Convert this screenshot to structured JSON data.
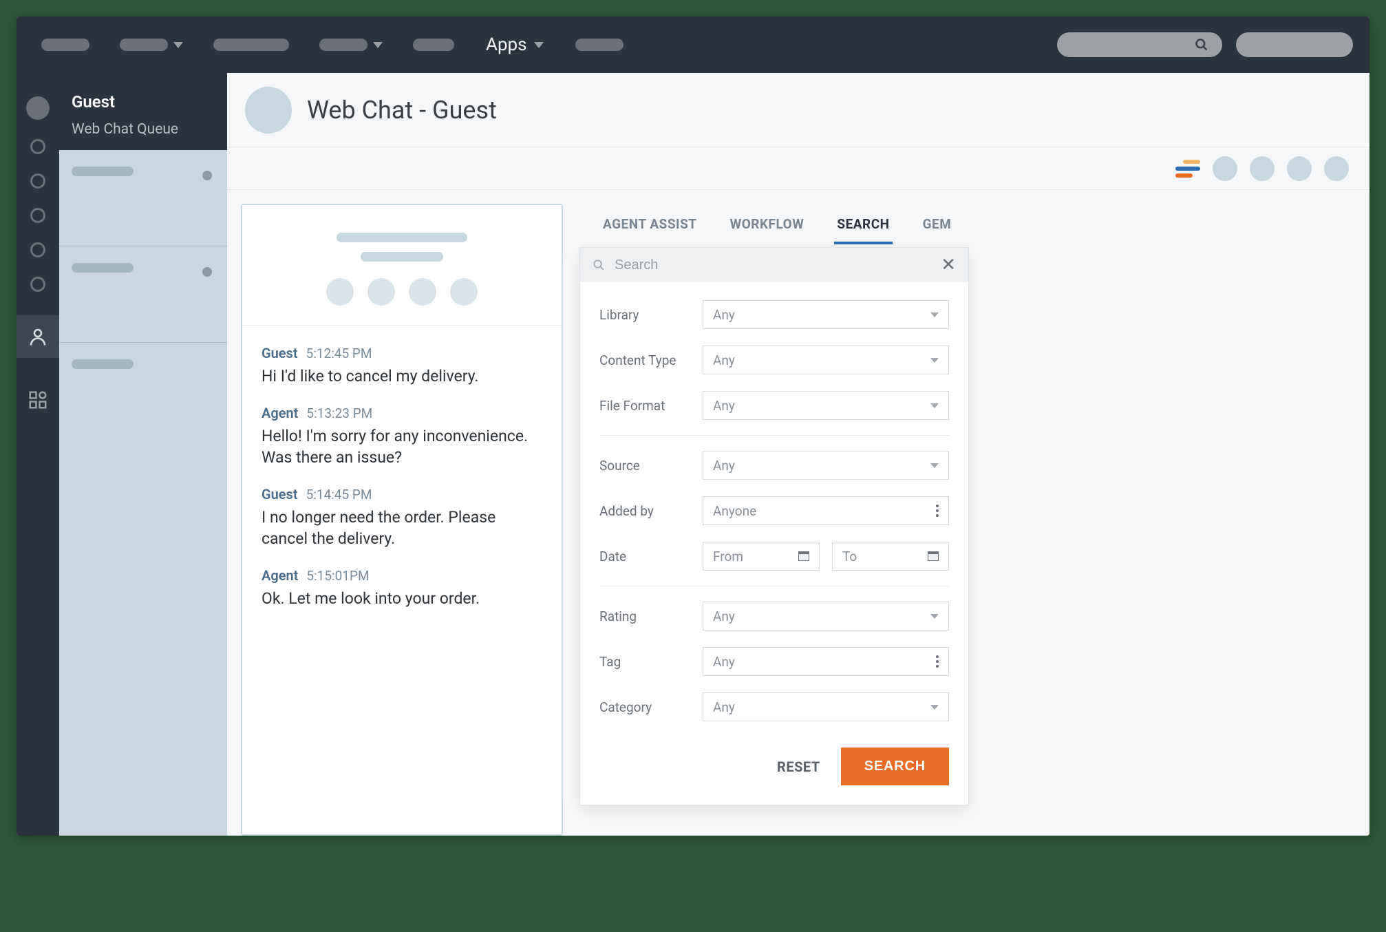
{
  "topbar": {
    "apps_label": "Apps"
  },
  "sidebar": {
    "title": "Guest",
    "subtitle": "Web Chat Queue"
  },
  "header": {
    "title": "Web Chat - Guest"
  },
  "tabs": {
    "agent_assist": "AGENT ASSIST",
    "workflow": "WORKFLOW",
    "search": "SEARCH",
    "gem": "GEM"
  },
  "chat": {
    "messages": [
      {
        "sender": "Guest",
        "time": "5:12:45 PM",
        "text": "Hi I'd like to cancel my delivery."
      },
      {
        "sender": "Agent",
        "time": "5:13:23 PM",
        "text": "Hello! I'm sorry for any inconvenience. Was there an issue?"
      },
      {
        "sender": "Guest",
        "time": "5:14:45 PM",
        "text": "I no longer need the order. Please cancel the delivery."
      },
      {
        "sender": "Agent",
        "time": "5:15:01PM",
        "text": "Ok. Let me look into your order."
      }
    ]
  },
  "search_panel": {
    "placeholder": "Search",
    "filters": {
      "library": {
        "label": "Library",
        "value": "Any"
      },
      "content_type": {
        "label": "Content Type",
        "value": "Any"
      },
      "file_format": {
        "label": "File Format",
        "value": "Any"
      },
      "source": {
        "label": "Source",
        "value": "Any"
      },
      "added_by": {
        "label": "Added by",
        "value": "Anyone"
      },
      "date": {
        "label": "Date",
        "from": "From",
        "to": "To"
      },
      "rating": {
        "label": "Rating",
        "value": "Any"
      },
      "tag": {
        "label": "Tag",
        "value": "Any"
      },
      "category": {
        "label": "Category",
        "value": "Any"
      }
    },
    "reset": "RESET",
    "search": "SEARCH"
  }
}
